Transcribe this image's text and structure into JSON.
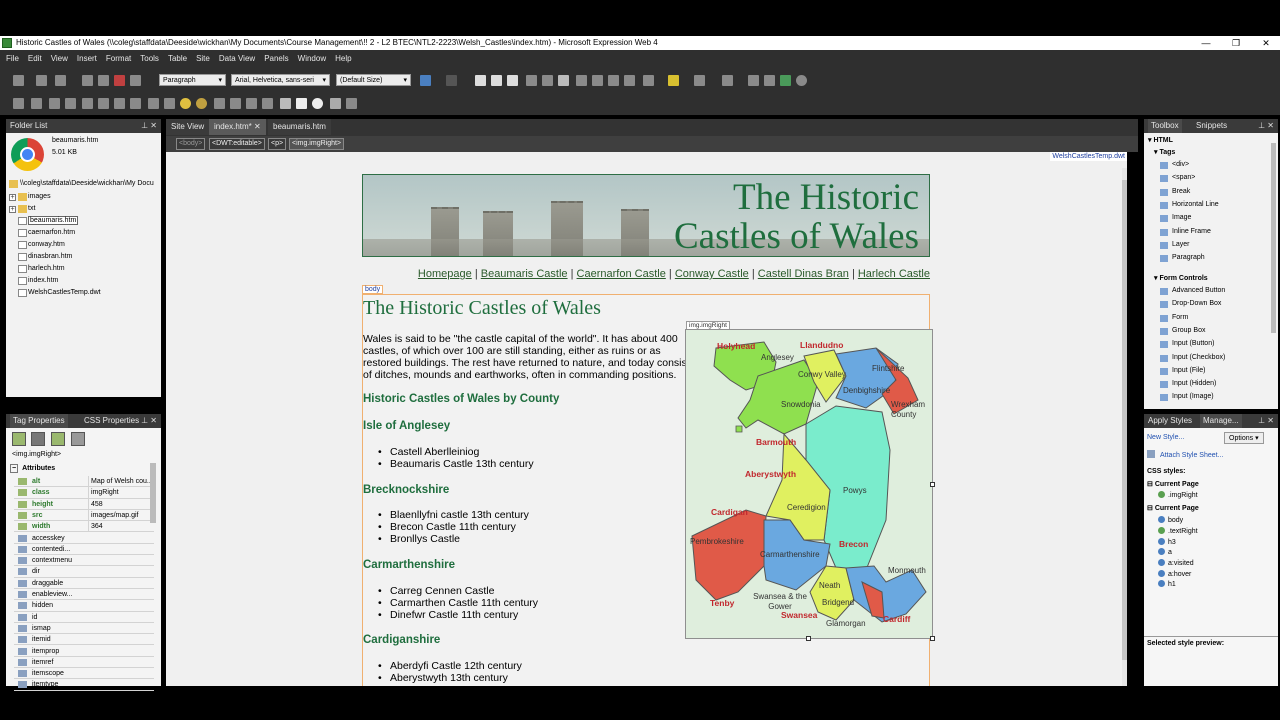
{
  "window": {
    "title": "Historic Castles of Wales (\\\\coleg\\staffdata\\Deeside\\wickhan\\My Documents\\Course Management\\!! 2 - L2 BTEC\\NTL2-2223\\Welsh_Castles\\index.htm) - Microsoft Expression Web 4"
  },
  "menu": [
    "File",
    "Edit",
    "View",
    "Insert",
    "Format",
    "Tools",
    "Table",
    "Site",
    "Data View",
    "Panels",
    "Window",
    "Help"
  ],
  "toolbar": {
    "style": "Paragraph",
    "font": "Arial, Helvetica, sans-seri",
    "size": "(Default Size)"
  },
  "folder_list": {
    "title": "Folder List",
    "preview_file": "beaumaris.htm",
    "preview_size": "5.01 KB",
    "root": "\\\\coleg\\staffdata\\Deeside\\wickhan\\My Docu",
    "items": [
      "images",
      "txt",
      "beaumaris.htm",
      "caernarfon.htm",
      "conway.htm",
      "dinasbran.htm",
      "harlech.htm",
      "index.htm",
      "WelshCastlesTemp.dwt"
    ]
  },
  "tag_props": {
    "tabs": [
      "Tag Properties",
      "CSS Properties"
    ],
    "element": "<img.imgRight>",
    "section": "Attributes",
    "rows": [
      {
        "name": "alt",
        "value": "Map of Welsh cou..."
      },
      {
        "name": "class",
        "value": "imgRight"
      },
      {
        "name": "height",
        "value": "458"
      },
      {
        "name": "src",
        "value": "images/map.gif"
      },
      {
        "name": "width",
        "value": "364"
      },
      {
        "name": "accesskey",
        "value": ""
      },
      {
        "name": "contentedi...",
        "value": ""
      },
      {
        "name": "contextmenu",
        "value": ""
      },
      {
        "name": "dir",
        "value": ""
      },
      {
        "name": "draggable",
        "value": ""
      },
      {
        "name": "enableview...",
        "value": ""
      },
      {
        "name": "hidden",
        "value": ""
      },
      {
        "name": "id",
        "value": ""
      },
      {
        "name": "ismap",
        "value": ""
      },
      {
        "name": "itemid",
        "value": ""
      },
      {
        "name": "itemprop",
        "value": ""
      },
      {
        "name": "itemref",
        "value": ""
      },
      {
        "name": "itemscope",
        "value": ""
      },
      {
        "name": "itemtype",
        "value": ""
      }
    ]
  },
  "doc_tabs": [
    "Site View",
    "index.htm*",
    "beaumaris.htm"
  ],
  "breadcrumb": [
    "<body>",
    "<DWT:editable>",
    "<p>",
    "<img.imgRight>"
  ],
  "template_label": "WelshCastlesTemp.dwt",
  "page": {
    "banner_line1": "The Historic",
    "banner_line2": "Castles of Wales",
    "nav": [
      "Homepage",
      "Beaumaris Castle",
      "Caernarfon Castle",
      "Conway Castle",
      "Castell Dinas Bran",
      "Harlech Castle"
    ],
    "nav_sep": "|",
    "body_tag": "body",
    "img_tag": "img.imgRight",
    "h1": "The Historic Castles of Wales",
    "intro_lines": [
      "Wales is said to be \"the castle capital of the world\". It has about 400",
      "castles, of which over 100 are still standing, either as ruins or as",
      "restored buildings. The rest have returned to nature, and today consist",
      "of ditches, mounds and earthworks, often in commanding positions."
    ],
    "subtitle": "Historic Castles of Wales by County",
    "sections": [
      {
        "heading": "Isle of Anglesey",
        "items": [
          "Castell Aberlleiniog",
          "Beaumaris Castle 13th century"
        ]
      },
      {
        "heading": "Brecknockshire",
        "items": [
          "Blaenllyfni castle 13th century",
          "Brecon Castle 11th century",
          "Bronllys Castle"
        ]
      },
      {
        "heading": "Carmarthenshire",
        "items": [
          "Carreg Cennen Castle",
          "Carmarthen Castle 11th century",
          "Dinefwr Castle 11th century"
        ]
      },
      {
        "heading": "Cardiganshire",
        "items": [
          "Aberdyfi Castle 12th century",
          "Aberystwyth 13th century"
        ]
      }
    ],
    "map_labels_red": [
      "Holyhead",
      "Llandudno",
      "Barmouth",
      "Aberystwyth",
      "Cardigan",
      "Brecon",
      "Tenby",
      "Swansea",
      "Cardiff"
    ],
    "map_labels_grey": [
      "Anglesey",
      "Conwy Valley",
      "Flintshire",
      "Denbighshire",
      "Wrexham County",
      "Snowdonia",
      "Powys",
      "Ceredigion",
      "Pembrokeshire",
      "Carmarthenshire",
      "Monmouth",
      "Neath",
      "Bridgend",
      "Glamorgan",
      "Swansea & the Gower"
    ]
  },
  "toolbox": {
    "tabs": [
      "Toolbox",
      "Snippets"
    ],
    "html": "HTML",
    "tags_header": "Tags",
    "tags": [
      "<div>",
      "<span>",
      "Break",
      "Horizontal Line",
      "Image",
      "Inline Frame",
      "Layer",
      "Paragraph"
    ],
    "forms_header": "Form Controls",
    "forms": [
      "Advanced Button",
      "Drop-Down Box",
      "Form",
      "Group Box",
      "Input (Button)",
      "Input (Checkbox)",
      "Input (File)",
      "Input (Hidden)",
      "Input (Image)"
    ]
  },
  "apply_styles": {
    "tabs": [
      "Apply Styles",
      "Manage..."
    ],
    "new_style": "New Style...",
    "options": "Options",
    "attach": "Attach Style Sheet...",
    "css_styles": "CSS styles:",
    "group1": "Current Page",
    "group1_items": [
      ".imgRight"
    ],
    "group2": "Current Page",
    "group2_items": [
      "body",
      ".textRight",
      "h3",
      "a",
      "a:visited",
      "a:hover",
      "h1"
    ],
    "preview": "Selected style preview:"
  }
}
